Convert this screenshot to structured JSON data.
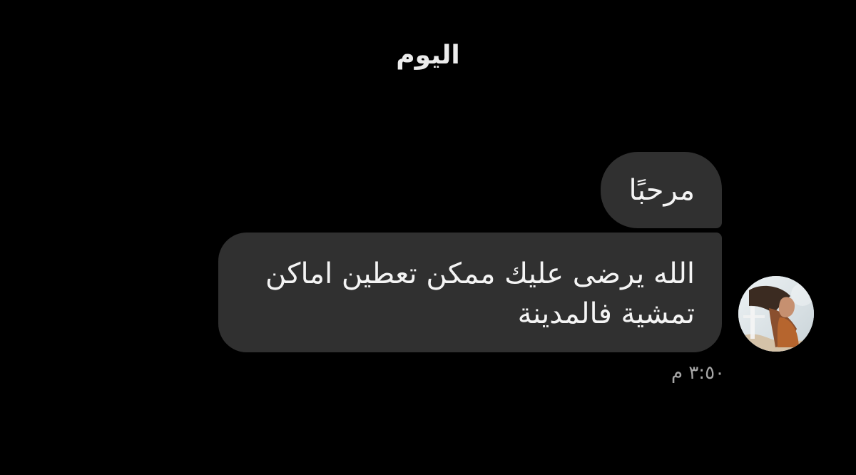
{
  "day_divider": {
    "label": "اليوم"
  },
  "messages": [
    {
      "text": "مرحبًا"
    },
    {
      "text": "الله يرضى عليك ممكن تعطين اماكن تمشية فالمدينة"
    }
  ],
  "timestamp": "٣:٥٠ م",
  "colors": {
    "background": "#000000",
    "bubble": "#303030",
    "text": "#f4f4f4",
    "timestamp": "#a7a7a7"
  }
}
